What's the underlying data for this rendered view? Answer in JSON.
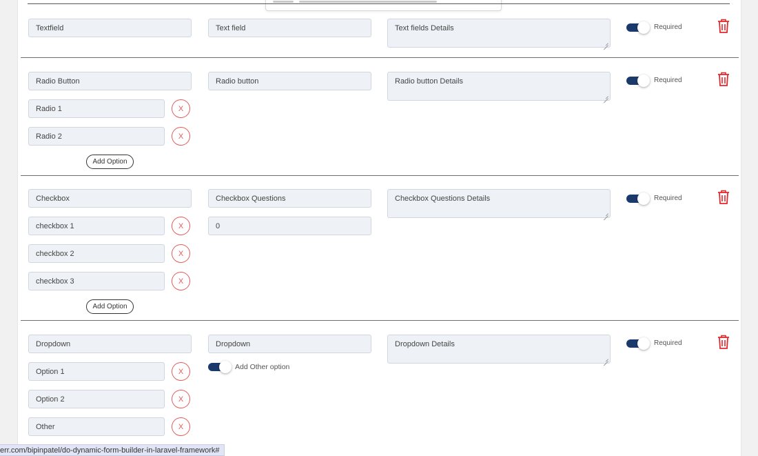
{
  "sections": [
    {
      "type_value": "Textfield",
      "question_value": "Text field",
      "details_value": "Text fields Details",
      "required_label": "Required",
      "options": [],
      "add_option_label": ""
    },
    {
      "type_value": "Radio Button",
      "question_value": "Radio button",
      "details_value": "Radio button Details",
      "required_label": "Required",
      "options": [
        "Radio 1",
        "Radio 2"
      ],
      "add_option_label": "Add Option"
    },
    {
      "type_value": "Checkbox",
      "question_value": "Checkbox Questions",
      "details_value": "Checkbox Questions Details",
      "required_label": "Required",
      "extra_value": "0",
      "options": [
        "checkbox 1",
        "checkbox 2",
        "checkbox 3"
      ],
      "add_option_label": "Add Option"
    },
    {
      "type_value": "Dropdown",
      "question_value": "Dropdown",
      "details_value": "Dropdown Details",
      "required_label": "Required",
      "add_other_label": "Add Other option",
      "options": [
        "Option 1",
        "Option 2",
        "Other"
      ],
      "add_option_label": ""
    }
  ],
  "remove_glyph": "X",
  "status_url": "err.com/bipinpatel/do-dynamic-form-builder-in-laravel-framework#",
  "colors": {
    "toggle_on": "#1b3a6b",
    "danger": "#e35a5a",
    "field_bg": "#eef2f7"
  },
  "icons": [
    "trash-icon",
    "close-icon"
  ]
}
